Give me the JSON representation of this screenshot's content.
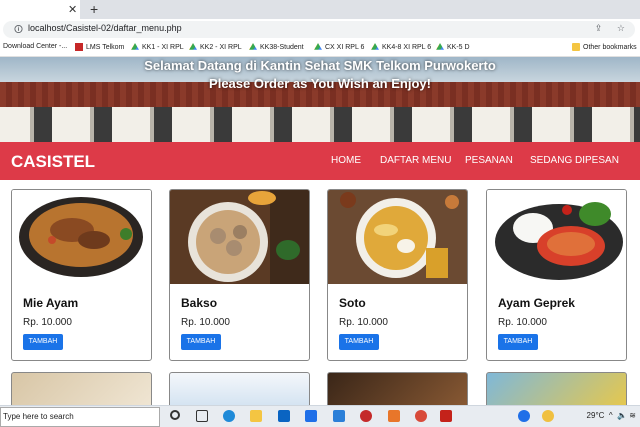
{
  "browser": {
    "url": "localhost/Casistel-02/daftar_menu.php",
    "new_tab": "+",
    "close_tab": "✕"
  },
  "bookmarks": [
    {
      "label": "Download Center -...",
      "icon": "download-icon"
    },
    {
      "label": "LMS Telkom",
      "icon": "lms-icon"
    },
    {
      "label": "KK1 - XI RPL",
      "icon": "drive-icon"
    },
    {
      "label": "KK2 - XI RPL",
      "icon": "drive-icon"
    },
    {
      "label": "KK38-Student",
      "icon": "drive-icon"
    },
    {
      "label": "CX XI RPL 6",
      "icon": "drive-icon"
    },
    {
      "label": "KK4-8 XI RPL 6",
      "icon": "drive-icon"
    },
    {
      "label": "KK-5 D",
      "icon": "drive-icon"
    },
    {
      "label": "Other bookmarks",
      "icon": "folder-icon"
    }
  ],
  "hero": {
    "line1": "Selamat Datang di Kantin Sehat SMK Telkom Purwokerto",
    "line2": "Please Order as You Wish an Enjoy!"
  },
  "navbar": {
    "brand": "CASISTEL",
    "links": [
      "HOME",
      "DAFTAR MENU",
      "PESANAN",
      "SEDANG DIPESAN"
    ],
    "color": "#dd3a48"
  },
  "menu": [
    {
      "name": "Mie Ayam",
      "price": "Rp. 10.000",
      "button": "TAMBAH"
    },
    {
      "name": "Bakso",
      "price": "Rp. 10.000",
      "button": "TAMBAH"
    },
    {
      "name": "Soto",
      "price": "Rp. 10.000",
      "button": "TAMBAH"
    },
    {
      "name": "Ayam Geprek",
      "price": "Rp. 10.000",
      "button": "TAMBAH"
    }
  ],
  "taskbar": {
    "search_placeholder": "Type here to search",
    "temperature": "29°C"
  }
}
